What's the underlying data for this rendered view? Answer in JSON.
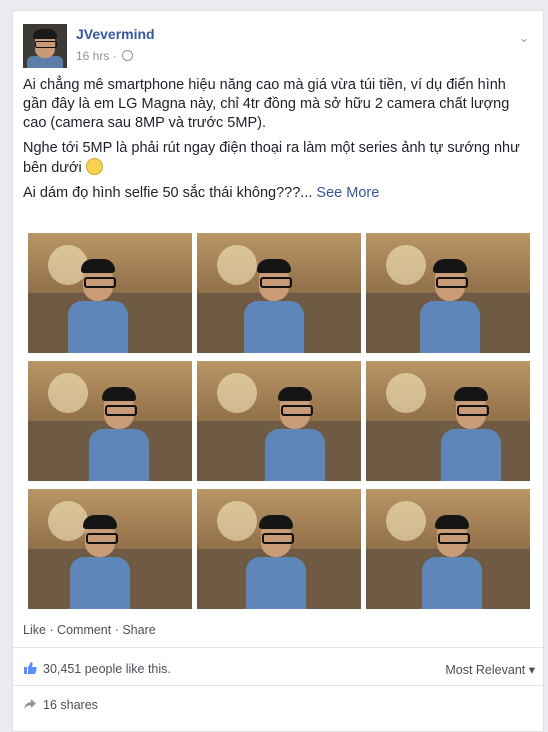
{
  "post": {
    "author": "JVevermind",
    "time": "16 hrs ·",
    "paragraphs": [
      "Ai chẳng mê smartphone hiệu năng cao mà giá vừa túi tiền, ví dụ điển hình gần đây là em LG Magna này, chỉ 4tr đồng mà sở hữu 2 camera chất lượng cao (camera sau 8MP và trước 5MP).",
      "Nghe tới 5MP là phải rút ngay điện thoại ra làm một series ảnh tự sướng như bên dưới",
      "Ai dám đọ hình selfie 50 sắc thái không???..."
    ],
    "see_more": "See More",
    "photo_icon": "photo-grid",
    "actions": {
      "like": "Like",
      "comment": "Comment",
      "share": "Share",
      "sep": " · "
    },
    "likes_text": "30,451 people like this.",
    "sort_label": "Most Relevant ▾",
    "shares_text": "16 shares"
  },
  "colors": {
    "link": "#365899",
    "meta": "#90949c",
    "text": "#1d2129"
  }
}
